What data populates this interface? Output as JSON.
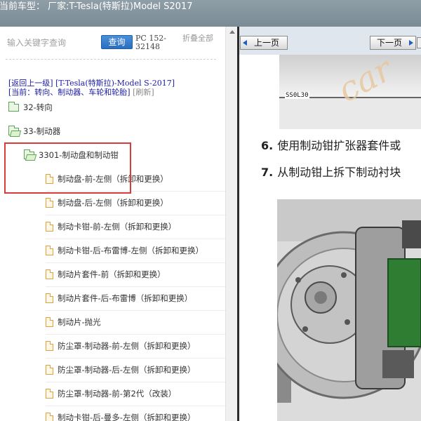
{
  "header": {
    "title": "当前车型：  厂家:T-Tesla(特斯拉)Model S2017"
  },
  "search": {
    "placeholder": "输入关键字查询",
    "button_label": "查询",
    "code": "PC 152-32148",
    "fold_all_label": "折叠全部"
  },
  "breadcrumb": {
    "back_link": "[返回上一级]",
    "model": "[T-Tesla(特斯拉)-Model S-2017]",
    "current": "[当前：转向、制动器、车轮和轮胎]",
    "refresh": "[刷新]"
  },
  "tree": {
    "folders": [
      {
        "label": "32-转向"
      },
      {
        "label": "33-制动器"
      },
      {
        "label": "3301-制动盘和制动钳"
      }
    ],
    "documents": [
      {
        "label": "制动盘-前-左侧（拆卸和更换）"
      },
      {
        "label": "制动盘-后-左侧（拆卸和更换）"
      },
      {
        "label": "制动卡钳-前-左侧（拆卸和更换）"
      },
      {
        "label": "制动卡钳-后-布雷博-左侧（拆卸和更换）"
      },
      {
        "label": "制动片套件-前（拆卸和更换）"
      },
      {
        "label": "制动片套件-后-布雷博（拆卸和更换）"
      },
      {
        "label": "制动片-抛光"
      },
      {
        "label": "防尘罩-制动器-前-左侧（拆卸和更换）"
      },
      {
        "label": "防尘罩-制动器-后-左侧（拆卸和更换）"
      },
      {
        "label": "防尘罩-制动器-前-第2代（改装）"
      },
      {
        "label": "制动卡钳-后-曼多-左侧（拆卸和更换）"
      }
    ]
  },
  "viewer": {
    "prev_label": "上一页",
    "next_label": "下一页",
    "photo_label": "SS0L30",
    "watermark": "car",
    "steps": [
      {
        "num": "6.",
        "text": "使用制动钳扩张器套件或"
      },
      {
        "num": "7.",
        "text": "从制动钳上拆下制动衬块"
      }
    ]
  },
  "colors": {
    "topbar": "#8596a0",
    "accent_blue": "#2a6fc0",
    "highlight_red": "#d93a3a",
    "folder_green": "#5aa55a",
    "doc_orange": "#e0a040",
    "caliper_green": "#2e7d32"
  }
}
